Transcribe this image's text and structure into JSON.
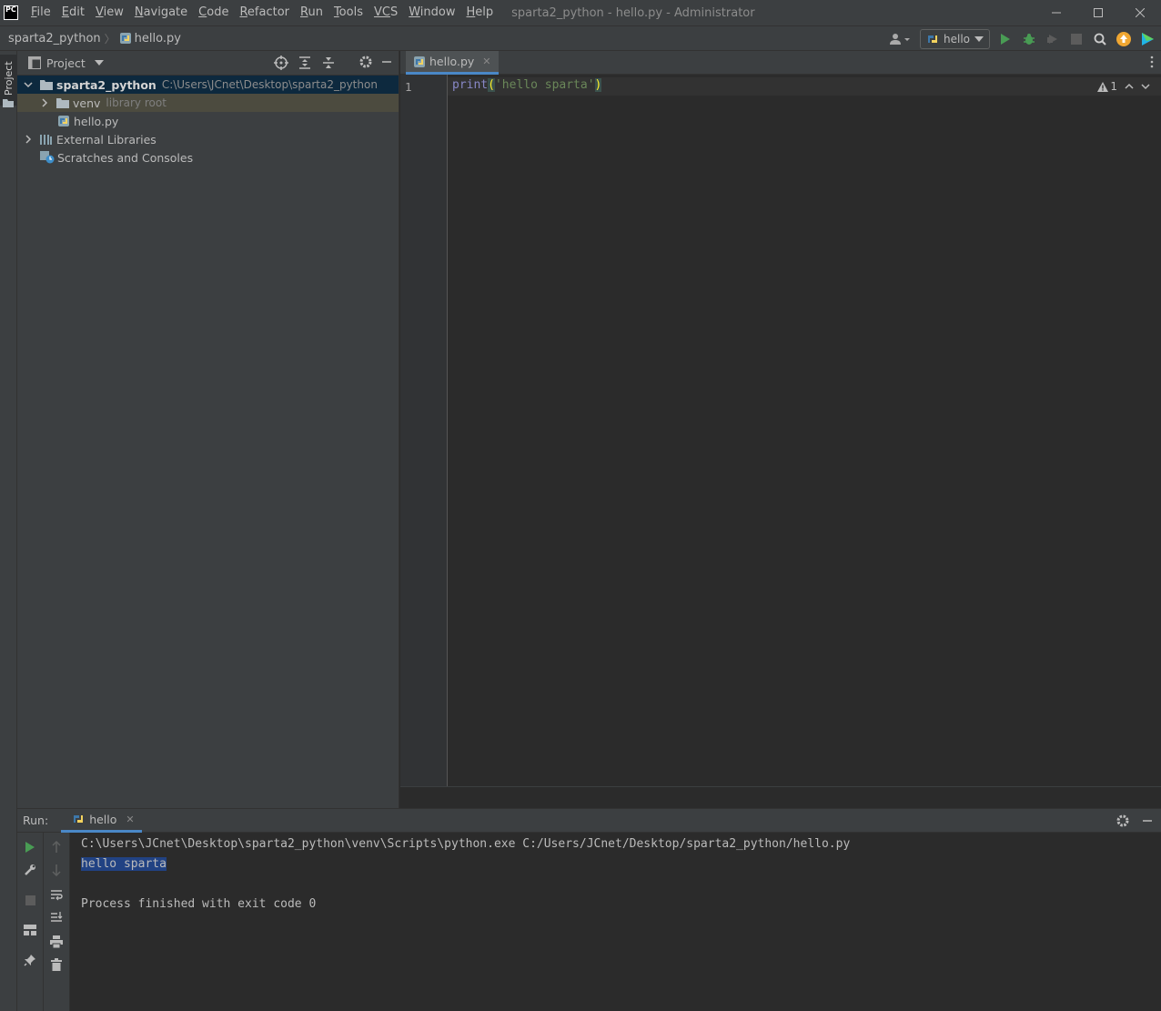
{
  "app": {
    "logo_text": "PC",
    "window_title": "sparta2_python - hello.py - Administrator"
  },
  "menu": [
    {
      "underline": "F",
      "rest": "ile"
    },
    {
      "underline": "E",
      "rest": "dit"
    },
    {
      "underline": "V",
      "rest": "iew"
    },
    {
      "underline": "N",
      "rest": "avigate"
    },
    {
      "underline": "C",
      "rest": "ode"
    },
    {
      "underline": "R",
      "rest": "efactor"
    },
    {
      "underline": "R",
      "rest": "un"
    },
    {
      "underline": "T",
      "rest": "ools"
    },
    {
      "underline": "VC",
      "rest": "S"
    },
    {
      "underline": "W",
      "rest": "indow"
    },
    {
      "underline": "H",
      "rest": "elp"
    }
  ],
  "breadcrumb": {
    "project": "sparta2_python",
    "file": "hello.py"
  },
  "toolbar": {
    "run_config": "hello"
  },
  "left_strip": {
    "project_tab": "Project"
  },
  "project_panel": {
    "title": "Project",
    "tree": {
      "root_name": "sparta2_python",
      "root_path": "C:\\Users\\JCnet\\Desktop\\sparta2_python",
      "venv_name": "venv",
      "venv_hint": "library root",
      "file_name": "hello.py",
      "external_libraries": "External Libraries",
      "scratches": "Scratches and Consoles"
    }
  },
  "editor": {
    "tab_label": "hello.py",
    "line_number": "1",
    "code": {
      "builtin": "print",
      "open_paren": "(",
      "string": "'hello sparta'",
      "close_paren": ")"
    },
    "warning_count": "1"
  },
  "run_panel": {
    "label": "Run:",
    "tab_label": "hello",
    "console": {
      "command": "C:\\Users\\JCnet\\Desktop\\sparta2_python\\venv\\Scripts\\python.exe C:/Users/JCnet/Desktop/sparta2_python/hello.py",
      "output": "hello sparta",
      "exit": "Process finished with exit code 0"
    }
  },
  "colors": {
    "accent": "#4a88c7",
    "run_green": "#499c54",
    "update_orange": "#f0a732"
  }
}
